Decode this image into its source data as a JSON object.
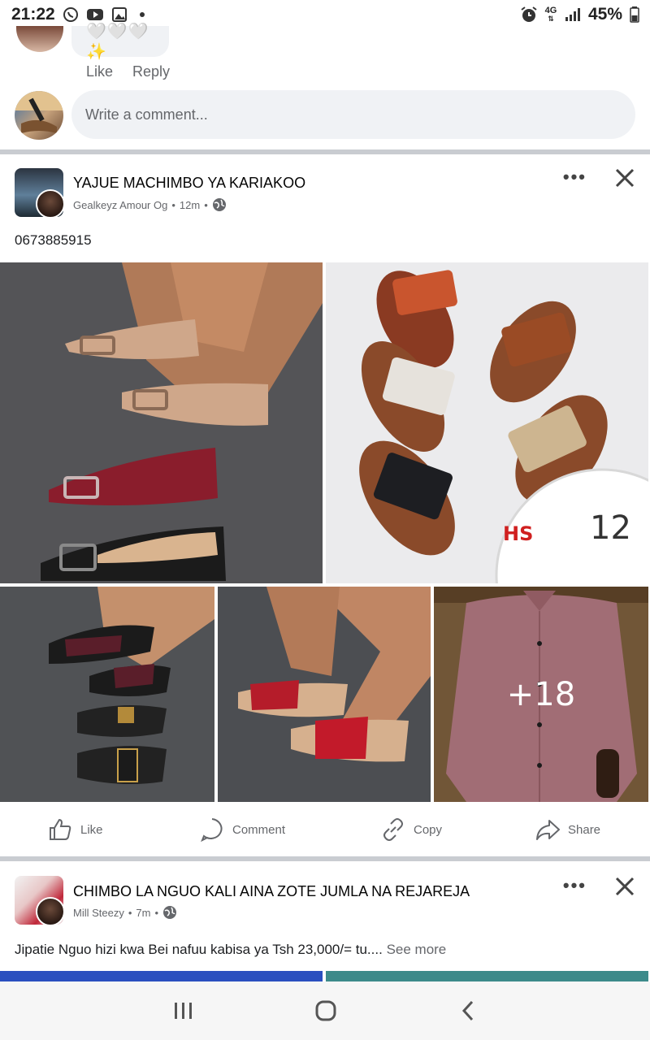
{
  "status_bar": {
    "time": "21:22",
    "battery": "45%",
    "network": "4G",
    "icons": [
      "whatsapp-icon",
      "youtube-icon",
      "gallery-icon",
      "alarm-icon",
      "signal-icon",
      "battery-icon"
    ]
  },
  "previous_comment": {
    "reaction_text": "🤍🤍🤍✨",
    "like_label": "Like",
    "reply_label": "Reply"
  },
  "comment_input": {
    "placeholder": "Write a comment..."
  },
  "posts": [
    {
      "title": "YAJUE MACHIMBO YA KARIAKOO",
      "author": "Gealkeyz Amour Og",
      "time": "12m",
      "text": "0673885915",
      "more_label": "•••",
      "extra_photos": "+18",
      "photo_watermark": "HS",
      "photo_clock_number": "12",
      "actions": {
        "like": "Like",
        "comment": "Comment",
        "copy": "Copy",
        "share": "Share"
      }
    },
    {
      "title": "CHIMBO LA NGUO KALI AINA ZOTE JUMLA NA REJAREJA",
      "author": "Mill Steezy",
      "time": "7m",
      "text": "Jipatie Nguo hizi kwa Bei nafuu kabisa ya Tsh 23,000/= tu....",
      "see_more": "See more",
      "more_label": "•••"
    }
  ],
  "colors": {
    "divider": "#c9ccd1",
    "input_bg": "#f0f2f5",
    "secondary_text": "#65676b"
  }
}
